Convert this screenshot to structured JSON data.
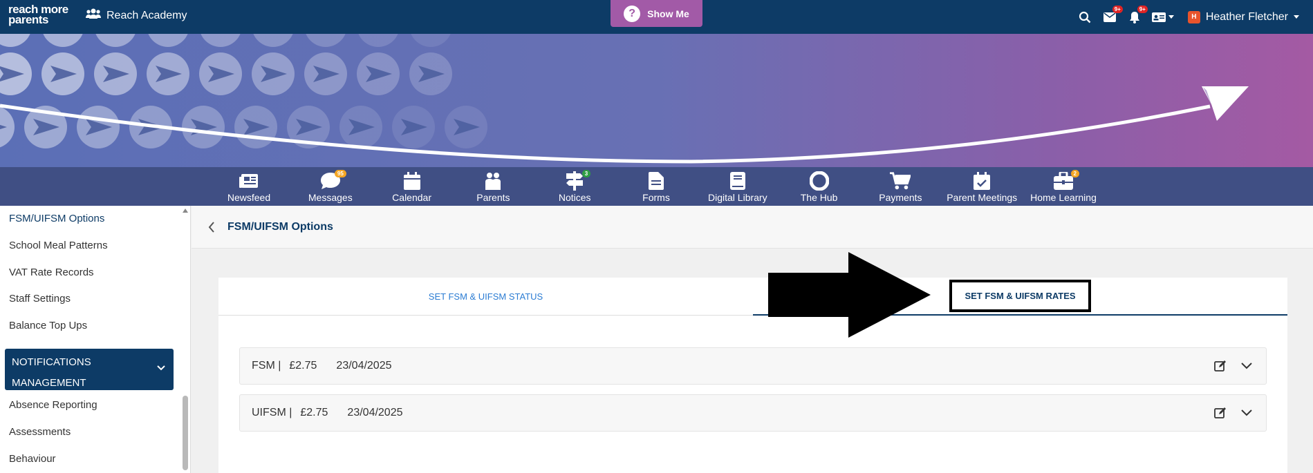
{
  "topbar": {
    "logo_line1": "reach more",
    "logo_line2": "parents",
    "school_name": "Reach Academy",
    "show_me_label": "Show Me",
    "messages_badge": "9+",
    "notifications_badge": "9+",
    "user_initial": "H",
    "user_name": "Heather Fletcher"
  },
  "nav": {
    "items": [
      {
        "label": "Newsfeed",
        "icon": "newspaper-icon"
      },
      {
        "label": "Messages",
        "icon": "chat-bubble-icon",
        "badge": "95"
      },
      {
        "label": "Calendar",
        "icon": "calendar-icon"
      },
      {
        "label": "Parents",
        "icon": "people-icon"
      },
      {
        "label": "Notices",
        "icon": "signpost-icon",
        "badge": "3"
      },
      {
        "label": "Forms",
        "icon": "document-icon"
      },
      {
        "label": "Digital Library",
        "icon": "book-icon"
      },
      {
        "label": "The Hub",
        "icon": "lifebuoy-icon"
      },
      {
        "label": "Payments",
        "icon": "cart-icon"
      },
      {
        "label": "Parent Meetings",
        "icon": "calendar-check-icon"
      },
      {
        "label": "Home Learning",
        "icon": "briefcase-icon",
        "badge": "2"
      }
    ]
  },
  "sidebar": {
    "items": [
      {
        "label": "FSM/UIFSM Options",
        "active": true
      },
      {
        "label": "School Meal Patterns"
      },
      {
        "label": "VAT Rate Records"
      },
      {
        "label": "Staff Settings"
      },
      {
        "label": "Balance Top Ups"
      }
    ],
    "group_line1": "NOTIFICATIONS",
    "group_line2": "MANAGEMENT",
    "sub_items": [
      {
        "label": "Absence Reporting"
      },
      {
        "label": "Assessments"
      },
      {
        "label": "Behaviour"
      }
    ]
  },
  "page": {
    "title": "FSM/UIFSM Options",
    "tabs": [
      {
        "label": "SET FSM & UIFSM STATUS"
      },
      {
        "label": "SET FSM & UIFSM RATES",
        "selected": true
      }
    ],
    "rates": [
      {
        "type": "FSM |",
        "amount": "£2.75",
        "date": "23/04/2025"
      },
      {
        "type": "UIFSM |",
        "amount": "£2.75",
        "date": "23/04/2025"
      }
    ]
  },
  "colors": {
    "navy": "#0d3b66",
    "show_me": "#a25aa7",
    "nav_strip": "#404f84",
    "badge_red": "#e02424",
    "badge_orange": "#f5a623",
    "badge_green": "#2e9e43",
    "tab_link": "#2b7cd3"
  }
}
